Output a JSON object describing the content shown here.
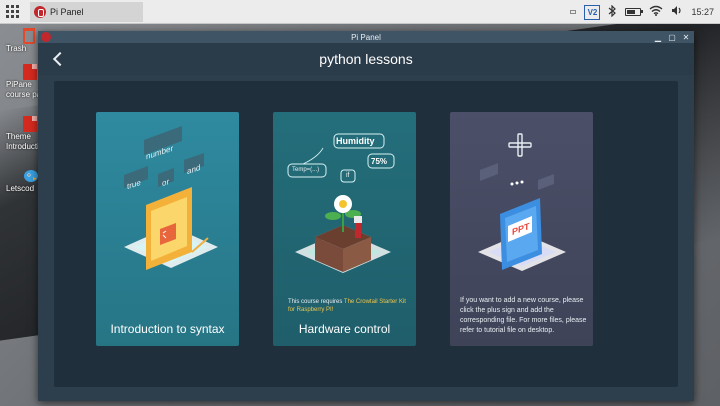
{
  "taskbar": {
    "menu_icon": "app-grid-icon",
    "active_task": {
      "label": "Pi Panel",
      "icon": "pi-panel-app-icon"
    },
    "tray": {
      "vnc_label": "V2",
      "clock": "15:27",
      "icons": [
        "window-rect-icon",
        "vnc-icon",
        "bluetooth-icon",
        "battery-icon",
        "wifi-icon",
        "volume-icon"
      ]
    }
  },
  "desktop": {
    "icons": [
      {
        "label": "Trash",
        "icon": "trash-icon"
      },
      {
        "label": "PiPane",
        "label2": "course pa",
        "icon": "pdf-icon"
      },
      {
        "label": "Theme",
        "label2": "Introducti",
        "icon": "pdf-icon"
      },
      {
        "label": "Letscod",
        "icon": "letscode-app-icon"
      }
    ]
  },
  "window": {
    "title": "Pi Panel",
    "controls": [
      "minimize",
      "maximize",
      "close"
    ],
    "header": {
      "title": "python lessons",
      "back_icon": "chevron-left-icon"
    },
    "cards": [
      {
        "title": "Introduction to syntax",
        "art_words": [
          "number",
          "true",
          "or",
          "and"
        ],
        "icon": "code-window-illustration"
      },
      {
        "title": "Hardware control",
        "art_words": [
          "Humidity",
          "Temp=(...)",
          "if",
          "75%"
        ],
        "note_prefix": "This course requires ",
        "note_highlight": "The Crowtail Starter Kit for Raspberry PI!",
        "icon": "plant-pot-illustration"
      },
      {
        "title": "",
        "art_words": [
          "PPT"
        ],
        "description": "If you want to add a new course, please click the plus sign and add the corresponding file. For more files, please refer to tutorial file on desktop.",
        "icon": "add-course-plus-icon"
      }
    ]
  },
  "colors": {
    "window_bg": "#2d3e4c",
    "content_bg": "#1f2f3b",
    "card_syntax": "#2f8aa0",
    "card_hardware": "#246e7b",
    "card_add": "#4b4f68",
    "highlight": "#f0c64a"
  }
}
